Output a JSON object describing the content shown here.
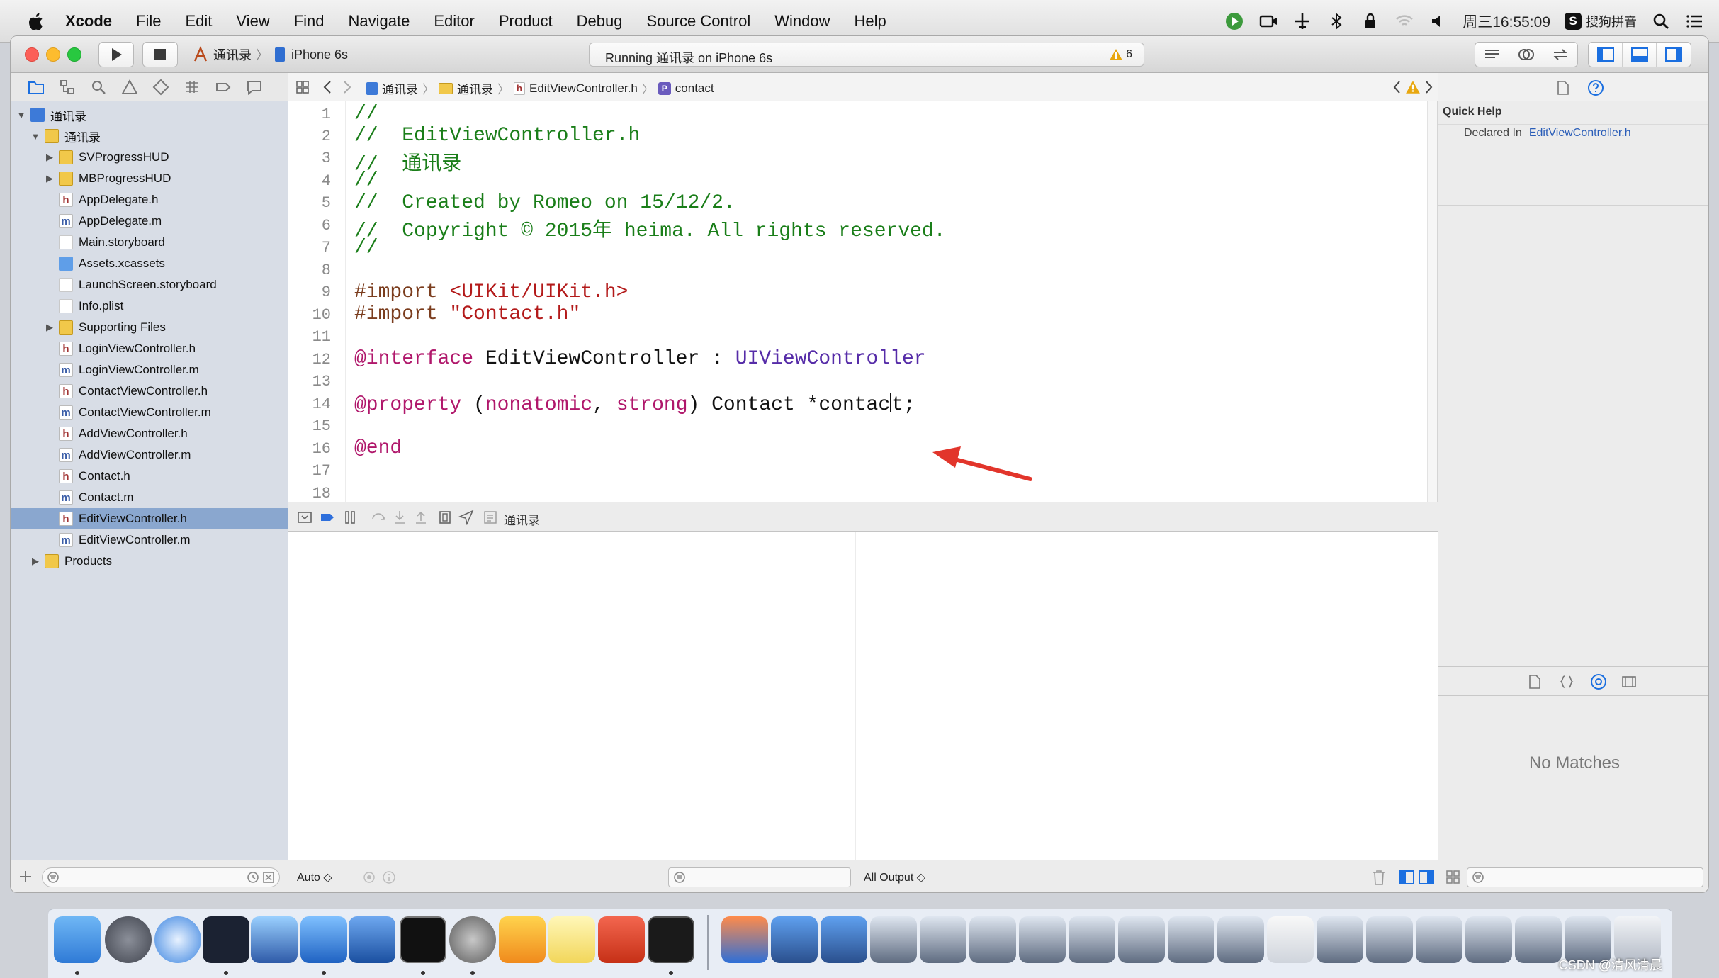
{
  "menubar": {
    "app_name": "Xcode",
    "items": [
      "File",
      "Edit",
      "View",
      "Find",
      "Navigate",
      "Editor",
      "Product",
      "Debug",
      "Source Control",
      "Window",
      "Help"
    ],
    "clock": "周三16:55:09",
    "input_method": "搜狗拼音"
  },
  "toolbar": {
    "scheme_project": "通讯录",
    "scheme_device": "iPhone 6s",
    "status_text": "Running 通讯录 on iPhone 6s",
    "warning_count": "6"
  },
  "navigator": {
    "project_name": "通讯录",
    "items": [
      {
        "label": "通讯录",
        "kind": "project"
      },
      {
        "label": "通讯录",
        "kind": "folder"
      },
      {
        "label": "SVProgressHUD",
        "kind": "folder"
      },
      {
        "label": "MBProgressHUD",
        "kind": "folder"
      },
      {
        "label": "AppDelegate.h",
        "kind": "h"
      },
      {
        "label": "AppDelegate.m",
        "kind": "m"
      },
      {
        "label": "Main.storyboard",
        "kind": "storyboard"
      },
      {
        "label": "Assets.xcassets",
        "kind": "assets"
      },
      {
        "label": "LaunchScreen.storyboard",
        "kind": "storyboard"
      },
      {
        "label": "Info.plist",
        "kind": "plist"
      },
      {
        "label": "Supporting Files",
        "kind": "folder"
      },
      {
        "label": "LoginViewController.h",
        "kind": "h"
      },
      {
        "label": "LoginViewController.m",
        "kind": "m"
      },
      {
        "label": "ContactViewController.h",
        "kind": "h"
      },
      {
        "label": "ContactViewController.m",
        "kind": "m"
      },
      {
        "label": "AddViewController.h",
        "kind": "h"
      },
      {
        "label": "AddViewController.m",
        "kind": "m"
      },
      {
        "label": "Contact.h",
        "kind": "h"
      },
      {
        "label": "Contact.m",
        "kind": "m"
      },
      {
        "label": "EditViewController.h",
        "kind": "h"
      },
      {
        "label": "EditViewController.m",
        "kind": "m"
      },
      {
        "label": "Products",
        "kind": "folder"
      }
    ],
    "selected": "EditViewController.h"
  },
  "jumpbar": {
    "crumbs": [
      "通讯录",
      "通讯录",
      "EditViewController.h",
      "contact"
    ]
  },
  "editor": {
    "line_numbers": [
      "1",
      "2",
      "3",
      "4",
      "5",
      "6",
      "7",
      "8",
      "9",
      "10",
      "11",
      "12",
      "13",
      "14",
      "15",
      "16",
      "17",
      "18"
    ],
    "lines": {
      "l1": "//",
      "l2": "//  EditViewController.h",
      "l3": "//  通讯录",
      "l4": "//",
      "l5": "//  Created by Romeo on 15/12/2.",
      "l6": "//  Copyright © 2015年 heima. All rights reserved.",
      "l7": "//",
      "l9_a": "#import ",
      "l9_b": "<UIKit/UIKit.h>",
      "l10_a": "#import ",
      "l10_b": "\"Contact.h\"",
      "l12_a": "@interface",
      "l12_b": " EditViewController : ",
      "l12_c": "UIViewController",
      "l15_a": "@property",
      "l15_b": " (",
      "l15_c": "nonatomic",
      "l15_d": ", ",
      "l15_e": "strong",
      "l15_f": ") Contact *contac",
      "l15_g": "t;",
      "l17": "@end"
    }
  },
  "debug": {
    "process_label": "通讯录",
    "auto_label": "Auto ◇",
    "output_label": "All Output ◇"
  },
  "inspector": {
    "quick_help_title": "Quick Help",
    "declared_in_label": "Declared In",
    "declared_in_file": "EditViewController.h",
    "no_matches": "No Matches"
  },
  "watermark": "CSDN @清风清晨",
  "colors": {
    "selection": "#8aa7cf",
    "comment": "#1a7e19",
    "keyword": "#b0176b",
    "class": "#562ca8",
    "string": "#b31a1a",
    "arrow": "#e2352b"
  }
}
